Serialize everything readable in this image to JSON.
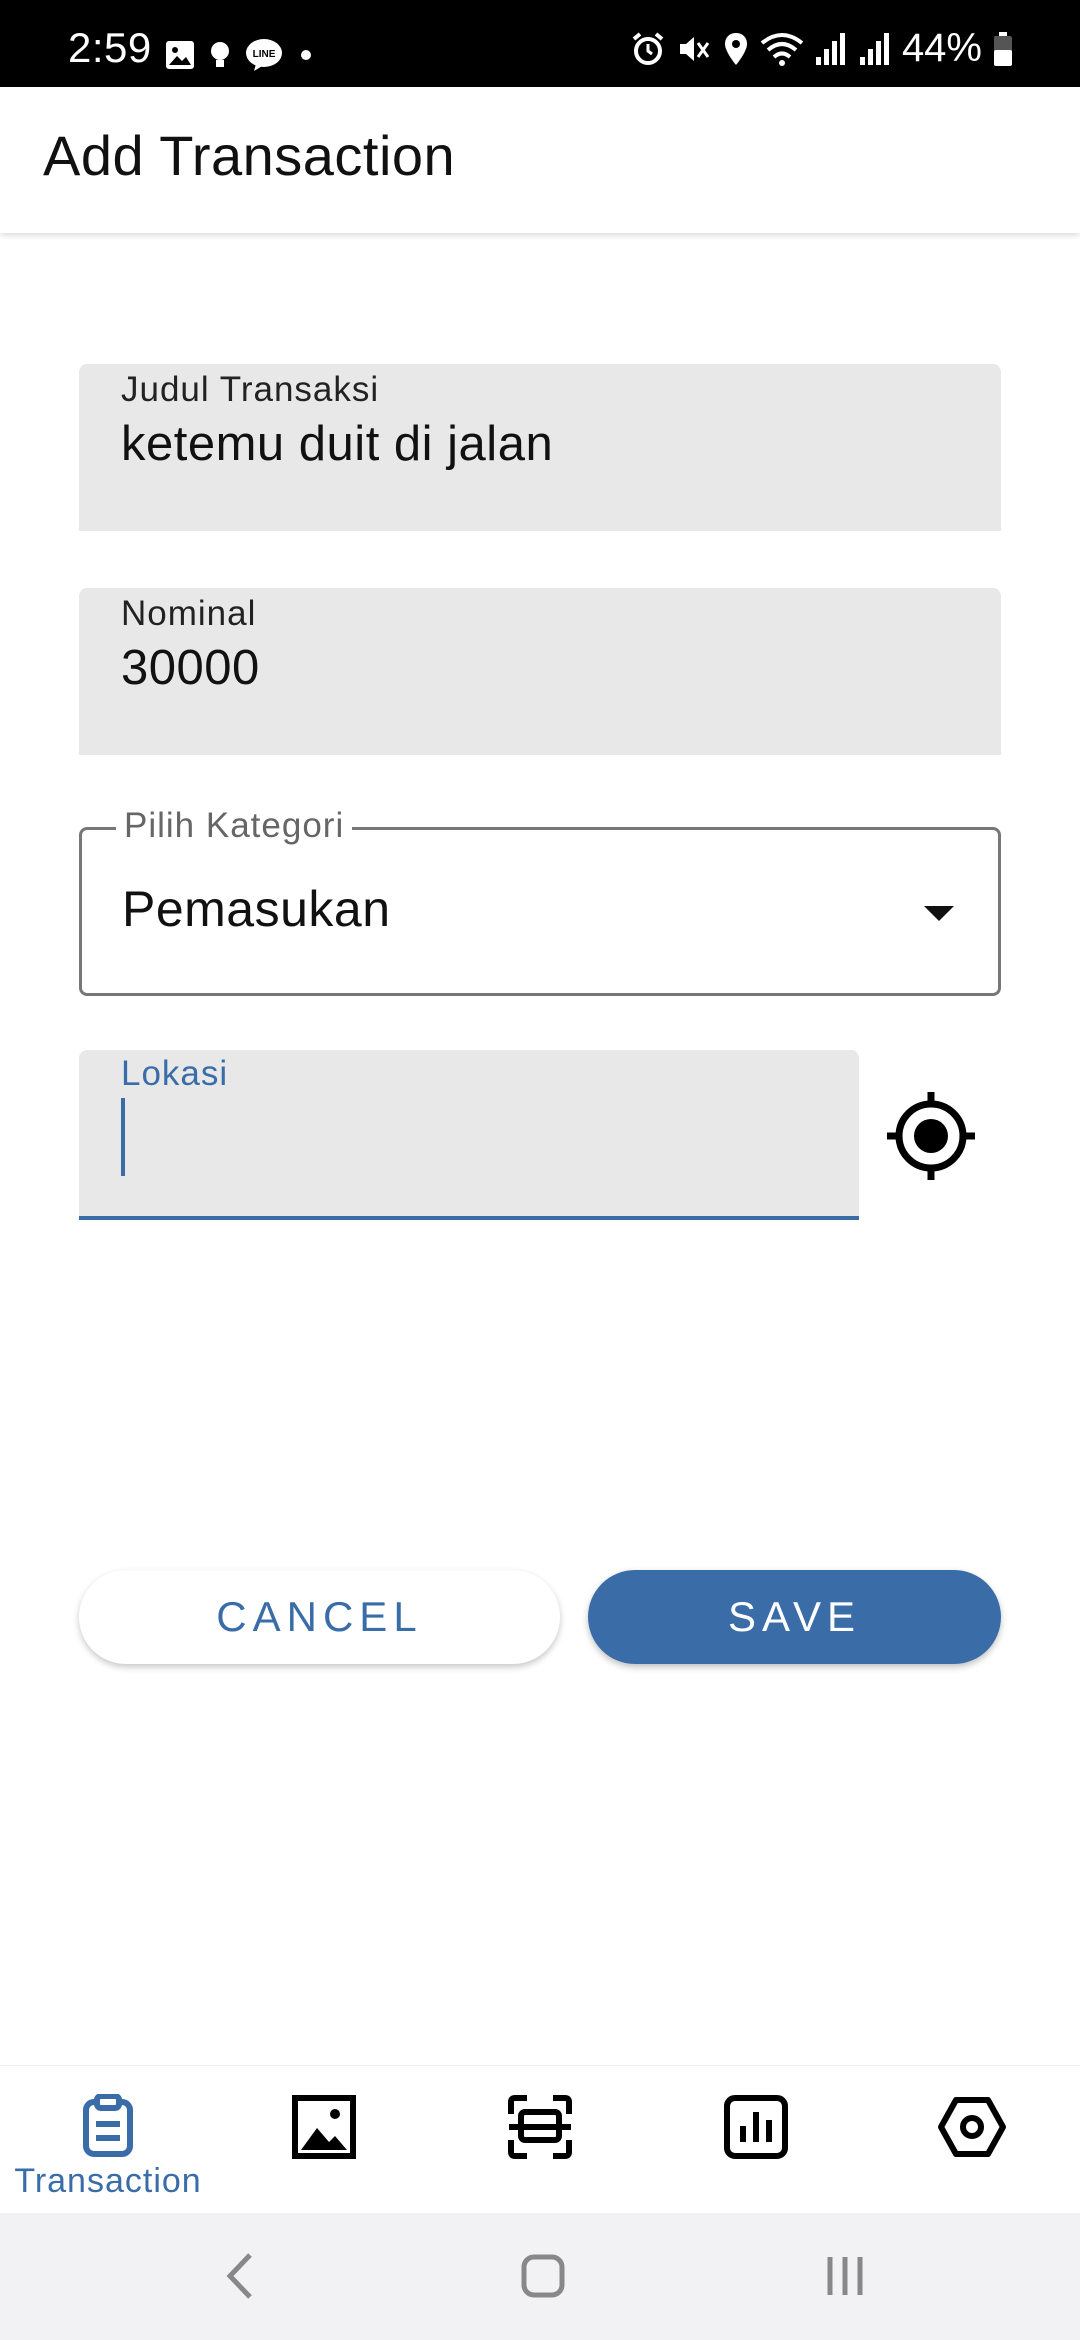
{
  "status_bar": {
    "time": "2:59",
    "battery": "44%",
    "left_icons": [
      "gallery-icon",
      "bulb-icon",
      "line-app-icon",
      "dot-icon"
    ],
    "right_icons": [
      "alarm-icon",
      "mute-vibrate-icon",
      "location-icon",
      "wifi-icon",
      "signal-icon",
      "signal-icon",
      "battery-icon"
    ]
  },
  "app_bar": {
    "title": "Add Transaction"
  },
  "form": {
    "title_field": {
      "label": "Judul Transaksi",
      "value": "ketemu duit di jalan"
    },
    "amount_field": {
      "label": "Nominal",
      "value": "30000"
    },
    "category_field": {
      "label": "Pilih Kategori",
      "value": "Pemasukan"
    },
    "location_field": {
      "label": "Lokasi",
      "value": ""
    }
  },
  "buttons": {
    "cancel": "CANCEL",
    "save": "SAVE"
  },
  "bottom_nav": {
    "items": [
      {
        "icon": "clipboard-icon",
        "label": "Transaction",
        "active": true
      },
      {
        "icon": "image-icon",
        "label": "",
        "active": false
      },
      {
        "icon": "scan-icon",
        "label": "",
        "active": false
      },
      {
        "icon": "chart-icon",
        "label": "",
        "active": false
      },
      {
        "icon": "settings-icon",
        "label": "",
        "active": false
      }
    ]
  },
  "colors": {
    "accent": "#3a6da8",
    "field_bg": "#e8e8e8",
    "status_bar": "#000000"
  }
}
